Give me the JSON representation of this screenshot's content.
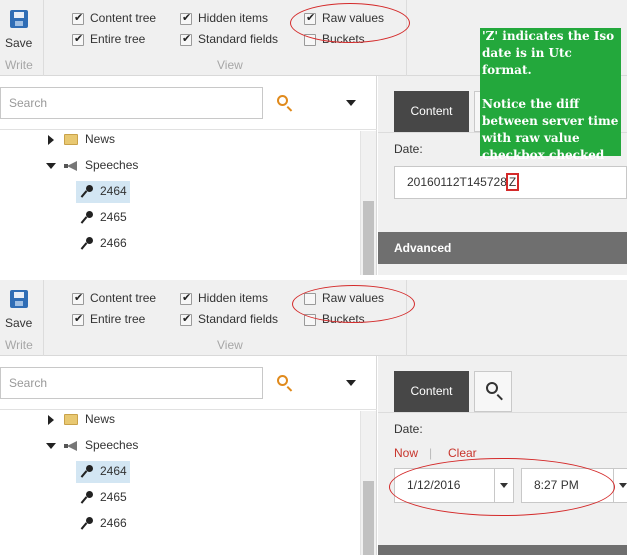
{
  "ribbon": {
    "save_label": "Save",
    "write_caption": "Write",
    "view_caption": "View",
    "checkboxes": [
      {
        "label": "Content tree"
      },
      {
        "label": "Entire tree"
      },
      {
        "label": "Hidden items"
      },
      {
        "label": "Standard fields"
      },
      {
        "label": "Raw values"
      },
      {
        "label": "Buckets"
      }
    ]
  },
  "search": {
    "placeholder": "Search"
  },
  "tree": {
    "items": [
      {
        "label": "News"
      },
      {
        "label": "Speeches"
      },
      {
        "label": "2464"
      },
      {
        "label": "2465"
      },
      {
        "label": "2466"
      }
    ]
  },
  "top_panel": {
    "checked": {
      "content_tree": true,
      "entire_tree": true,
      "hidden_items": true,
      "standard_fields": true,
      "raw_values": true,
      "buckets": false
    },
    "tab_label": "Content",
    "field_label": "Date:",
    "raw_value": "20160112T145728",
    "raw_value_suffix": "Z",
    "section_label": "Advanced"
  },
  "bottom_panel": {
    "checked": {
      "content_tree": true,
      "entire_tree": true,
      "hidden_items": true,
      "standard_fields": true,
      "raw_values": false,
      "buckets": false
    },
    "tab_label": "Content",
    "field_label": "Date:",
    "now_label": "Now",
    "separator": "|",
    "clear_label": "Clear",
    "date_value": "1/12/2016",
    "time_value": "8:27 PM"
  },
  "annotation": {
    "line1": "'Z' indicates the Iso date is in Utc format.",
    "line2": "Notice the diff between server time with raw value checkbox checked"
  },
  "colors": {
    "annotation_green": "#23a83c",
    "highlight_red": "#d42a2a",
    "selected_tree_bg": "#d3e6f3",
    "tab_active_bg": "#474747",
    "link_red": "#c8352c",
    "save_icon_blue": "#2f6db5",
    "search_icon_orange": "#e08a1c"
  }
}
